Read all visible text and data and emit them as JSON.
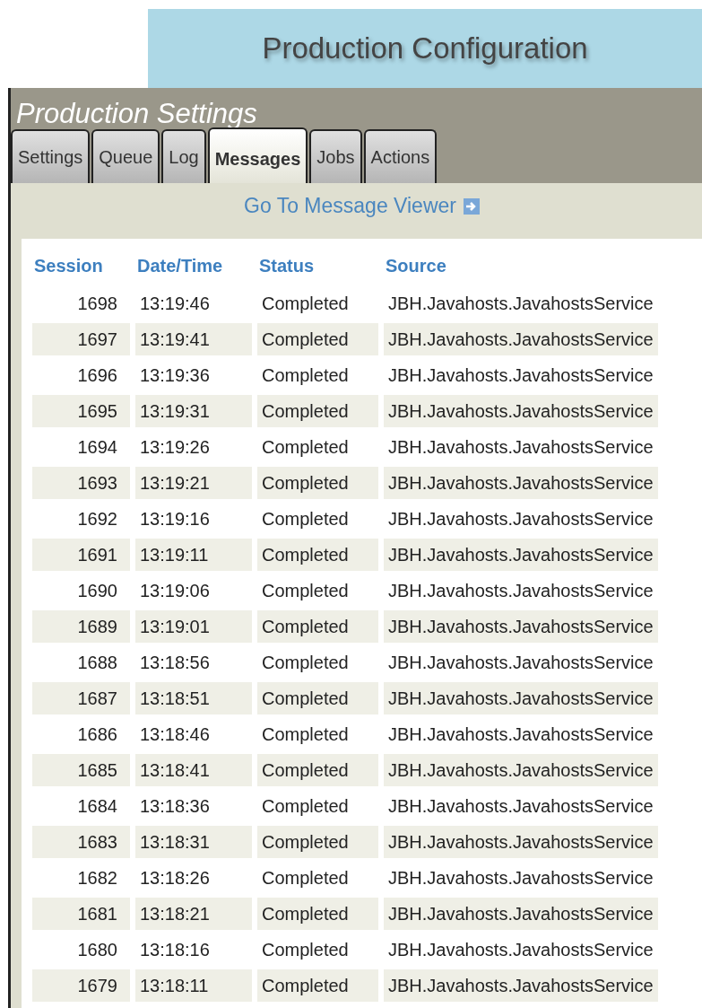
{
  "header": {
    "title": "Production Configuration"
  },
  "panel": {
    "title": "Production Settings"
  },
  "tabs": [
    {
      "label": "Settings",
      "selected": false
    },
    {
      "label": "Queue",
      "selected": false
    },
    {
      "label": "Log",
      "selected": false
    },
    {
      "label": "Messages",
      "selected": true
    },
    {
      "label": "Jobs",
      "selected": false
    },
    {
      "label": "Actions",
      "selected": false
    }
  ],
  "link": {
    "label": "Go To Message Viewer"
  },
  "table": {
    "columns": [
      "Session",
      "Date/Time",
      "Status",
      "Source"
    ],
    "rows": [
      [
        "1698",
        "13:19:46",
        "Completed",
        "JBH.Javahosts.JavahostsService"
      ],
      [
        "1697",
        "13:19:41",
        "Completed",
        "JBH.Javahosts.JavahostsService"
      ],
      [
        "1696",
        "13:19:36",
        "Completed",
        "JBH.Javahosts.JavahostsService"
      ],
      [
        "1695",
        "13:19:31",
        "Completed",
        "JBH.Javahosts.JavahostsService"
      ],
      [
        "1694",
        "13:19:26",
        "Completed",
        "JBH.Javahosts.JavahostsService"
      ],
      [
        "1693",
        "13:19:21",
        "Completed",
        "JBH.Javahosts.JavahostsService"
      ],
      [
        "1692",
        "13:19:16",
        "Completed",
        "JBH.Javahosts.JavahostsService"
      ],
      [
        "1691",
        "13:19:11",
        "Completed",
        "JBH.Javahosts.JavahostsService"
      ],
      [
        "1690",
        "13:19:06",
        "Completed",
        "JBH.Javahosts.JavahostsService"
      ],
      [
        "1689",
        "13:19:01",
        "Completed",
        "JBH.Javahosts.JavahostsService"
      ],
      [
        "1688",
        "13:18:56",
        "Completed",
        "JBH.Javahosts.JavahostsService"
      ],
      [
        "1687",
        "13:18:51",
        "Completed",
        "JBH.Javahosts.JavahostsService"
      ],
      [
        "1686",
        "13:18:46",
        "Completed",
        "JBH.Javahosts.JavahostsService"
      ],
      [
        "1685",
        "13:18:41",
        "Completed",
        "JBH.Javahosts.JavahostsService"
      ],
      [
        "1684",
        "13:18:36",
        "Completed",
        "JBH.Javahosts.JavahostsService"
      ],
      [
        "1683",
        "13:18:31",
        "Completed",
        "JBH.Javahosts.JavahostsService"
      ],
      [
        "1682",
        "13:18:26",
        "Completed",
        "JBH.Javahosts.JavahostsService"
      ],
      [
        "1681",
        "13:18:21",
        "Completed",
        "JBH.Javahosts.JavahostsService"
      ],
      [
        "1680",
        "13:18:16",
        "Completed",
        "JBH.Javahosts.JavahostsService"
      ],
      [
        "1679",
        "13:18:11",
        "Completed",
        "JBH.Javahosts.JavahostsService"
      ]
    ]
  }
}
